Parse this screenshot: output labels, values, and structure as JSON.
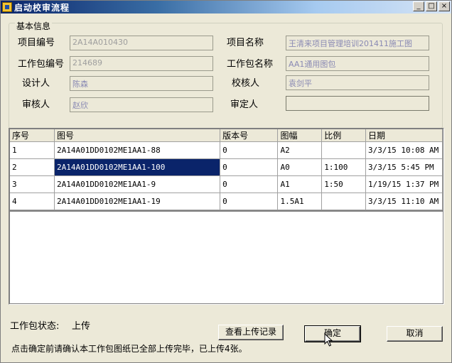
{
  "window": {
    "title": "启动校审流程",
    "min": "_",
    "max": "□",
    "close": "×"
  },
  "basic_info": {
    "legend": "基本信息",
    "project_code_label": "项目编号",
    "project_code": "2A14A010430",
    "project_name_label": "项目名称",
    "project_name": "王清来项目管理培训201411施工图",
    "package_code_label": "工作包编号",
    "package_code": "214689",
    "package_name_label": "工作包名称",
    "package_name": "AA1通用图包",
    "designer_label": "设计人",
    "designer": "陈森",
    "checker_label": "校核人",
    "checker": "袁剑平",
    "reviewer_label": "审核人",
    "reviewer": "赵欣",
    "approver_label": "审定人",
    "approver": ""
  },
  "table": {
    "columns": [
      "序号",
      "图号",
      "版本号",
      "图幅",
      "比例",
      "日期"
    ],
    "rows": [
      [
        "1",
        "2A14A01DD0102ME1AA1-88",
        "0",
        "A2",
        "",
        "3/3/15 10:08 AM"
      ],
      [
        "2",
        "2A14A01DD0102ME1AA1-100",
        "0",
        "A0",
        "1:100",
        "3/3/15 5:45 PM"
      ],
      [
        "3",
        "2A14A01DD0102ME1AA1-9",
        "0",
        "A1",
        "1:50",
        "1/19/15 1:37 PM"
      ],
      [
        "4",
        "2A14A01DD0102ME1AA1-19",
        "0",
        "1.5A1",
        "",
        "3/3/15 11:10 AM"
      ]
    ],
    "selected_row": 2
  },
  "status": {
    "label": "工作包状态:",
    "value": "上传"
  },
  "note": "点击确定前请确认本工作包图纸已全部上传完毕，已上传4张。",
  "buttons": {
    "view_upload": "查看上传记录",
    "ok": "确定",
    "cancel": "取消"
  }
}
